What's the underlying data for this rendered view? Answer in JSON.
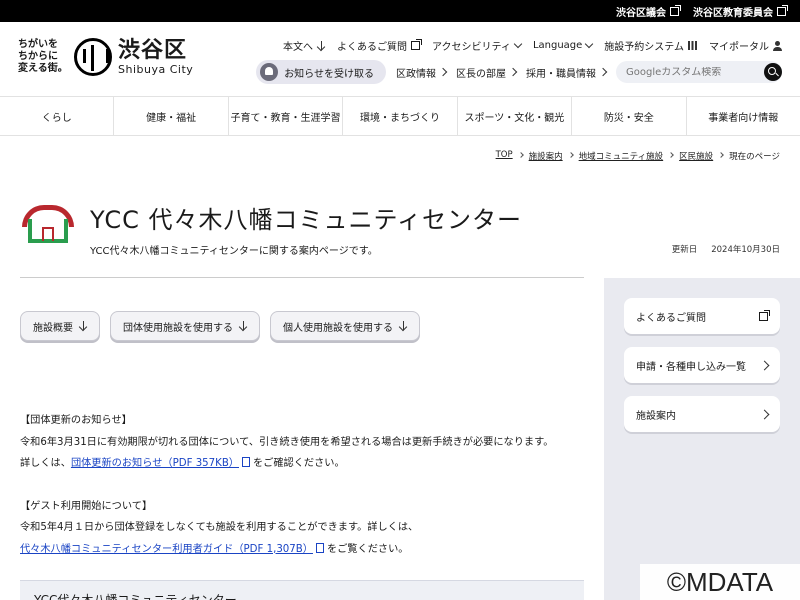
{
  "topbar": {
    "links": [
      "渋谷区議会",
      "渋谷区教育委員会"
    ]
  },
  "logo": {
    "tagline_line1": "ちがいを",
    "tagline_line2": "ちからに",
    "tagline_line3": "変える街。",
    "name_jp": "渋谷区",
    "name_en": "Shibuya City"
  },
  "util_nav": {
    "honbun": "本文へ",
    "faq": "よくあるご質問",
    "accessibility": "アクセシビリティ",
    "language": "Language",
    "reservation": "施設予約システム",
    "myportal": "マイポータル"
  },
  "row2": {
    "notify": "お知らせを受け取る",
    "kusei": "区政情報",
    "mayor": "区長の部屋",
    "recruit": "採用・職員情報"
  },
  "search": {
    "placeholder": "Googleカスタム検索"
  },
  "mainnav": [
    "くらし",
    "健康・福祉",
    "子育て・教育・生涯学習",
    "環境・まちづくり",
    "スポーツ・文化・観光",
    "防災・安全",
    "事業者向け情報"
  ],
  "breadcrumb": {
    "items": [
      "TOP",
      "施設案内",
      "地域コミュニティ施設",
      "区民施設"
    ],
    "current": "現在のページ"
  },
  "page": {
    "title": "YCC 代々木八幡コミュニティセンター",
    "subtitle": "YCC代々木八幡コミュニティセンターに関する案内ページです。",
    "updated_label": "更新日",
    "updated_date": "2024年10月30日"
  },
  "anchors": [
    "施設概要",
    "団体使用施設を使用する",
    "個人使用施設を使用する"
  ],
  "content": {
    "p1_heading": "【団体更新のお知らせ】",
    "p1_line1": "令和6年3月31日に有効期限が切れる団体について、引き続き使用を希望される場合は更新手続きが必要になります。",
    "p1_pre": "詳しくは、",
    "p1_link": "団体更新のお知らせ（PDF 357KB）",
    "p1_post": "をご確認ください。",
    "p2_heading": "【ゲスト利用開始について】",
    "p2_line1": "令和5年4月１日から団体登録をしなくても施設を利用することができます。詳しくは、",
    "p2_link": "代々木八幡コミュニティセンター利用者ガイド（PDF 1,307B）",
    "p2_post": "をご覧ください。"
  },
  "section_box": {
    "title": "YCC代々木八幡コミュニティセンター"
  },
  "sidebar": {
    "faq": "よくあるご質問",
    "forms": "申請・各種申し込み一覧",
    "facilities": "施設案内"
  },
  "watermark": "©MDATA",
  "colors": {
    "roof": "#b9282e",
    "house": "#2a9d4e",
    "link": "#1a44c4"
  }
}
